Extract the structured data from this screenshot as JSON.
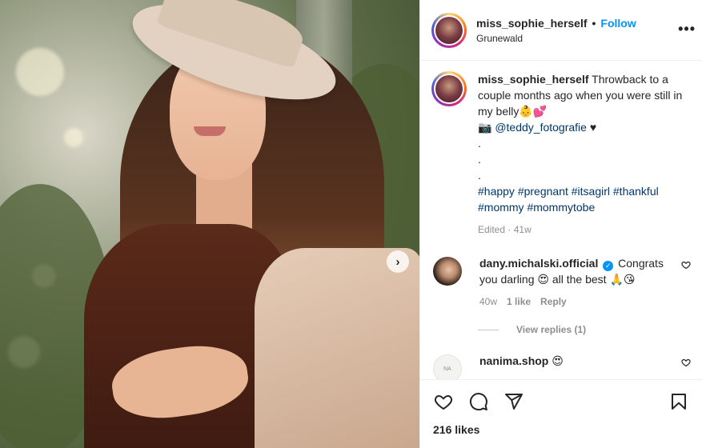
{
  "post": {
    "username": "miss_sophie_herself",
    "separator": "•",
    "follow_label": "Follow",
    "location": "Grunewald",
    "more_icon": "more-horizontal-icon",
    "next_icon": "chevron-right-icon"
  },
  "caption": {
    "username": "miss_sophie_herself",
    "text": "Throwback to a couple months ago when you were still in my belly👶💕",
    "camera": "📷",
    "mention": "@teddy_fotografie",
    "heart": "♥",
    "dots": [
      ".",
      ".",
      "."
    ],
    "hashtags_line1": "#happy #pregnant #itsagirl #thankful",
    "hashtags_line2": "#mommy #mommytobe",
    "edited": "Edited",
    "separator": "·",
    "age": "41w"
  },
  "comments": [
    {
      "username": "dany.michalski.official",
      "verified": true,
      "text": "Congrats you darling 😍 all the best 🙏😘",
      "time": "40w",
      "likes": "1 like",
      "reply_label": "Reply",
      "view_replies": "View replies (1)"
    },
    {
      "username": "nanima.shop",
      "avatar_text": "NA",
      "text": "😍"
    }
  ],
  "actions": {
    "like_icon": "heart-icon",
    "comment_icon": "comment-icon",
    "share_icon": "share-icon",
    "save_icon": "bookmark-icon",
    "likes": "216 likes"
  },
  "colors": {
    "accent": "#0095f6",
    "muted": "#8e8e8e",
    "link": "#00376b",
    "text": "#262626"
  }
}
